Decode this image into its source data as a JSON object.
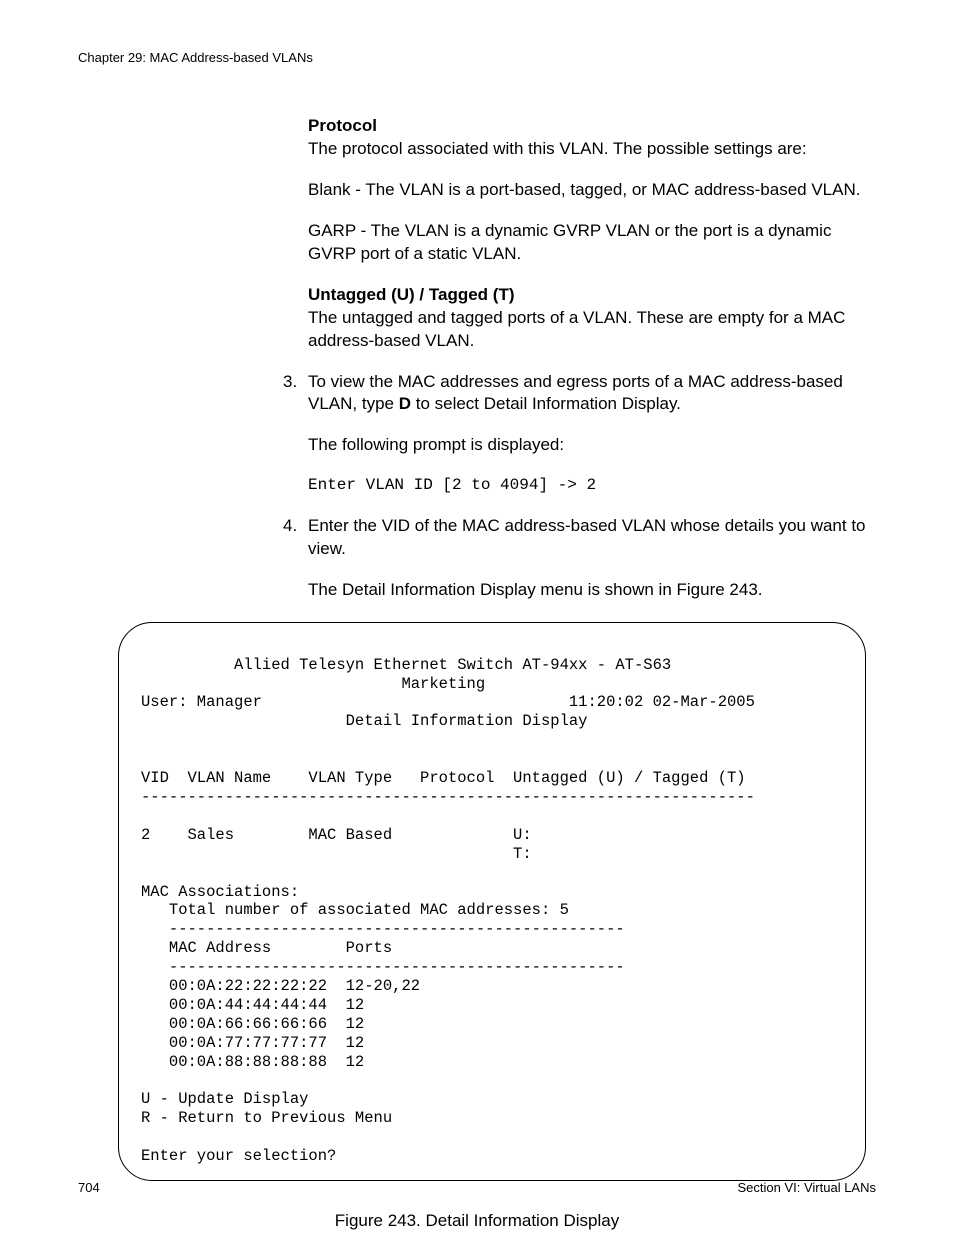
{
  "header": {
    "chapter": "Chapter 29: MAC Address-based VLANs"
  },
  "protocol": {
    "title": "Protocol",
    "desc": "The protocol associated with this VLAN. The possible settings are:",
    "blank": "Blank - The VLAN is a port-based, tagged, or MAC address-based VLAN.",
    "garp": "GARP - The VLAN is a dynamic GVRP VLAN or the port is a dynamic GVRP port of a static VLAN."
  },
  "untagged": {
    "title": "Untagged (U) / Tagged (T)",
    "desc": "The untagged and tagged ports of a VLAN. These are empty for a MAC address-based VLAN."
  },
  "step3": {
    "marker": "3.",
    "text_a": "To view the MAC addresses and egress ports of a MAC address-based VLAN, type ",
    "key": "D",
    "text_b": " to select Detail Information Display.",
    "followup": "The following prompt is displayed:",
    "prompt": "Enter VLAN ID [2 to 4094] -> 2"
  },
  "step4": {
    "marker": "4.",
    "text": "Enter the VID of the MAC address-based VLAN whose details you want to view.",
    "followup": "The Detail Information Display menu is shown in Figure 243."
  },
  "terminal": {
    "line1": "          Allied Telesyn Ethernet Switch AT-94xx - AT-S63",
    "line2": "                            Marketing",
    "line3": "User: Manager                                 11:20:02 02-Mar-2005",
    "line4": "                      Detail Information Display",
    "blank": "",
    "hdr": "VID  VLAN Name    VLAN Type   Protocol  Untagged (U) / Tagged (T)",
    "rule1": "------------------------------------------------------------------",
    "row1": "2    Sales        MAC Based             U:",
    "row1b": "                                        T:",
    "assoc": "MAC Associations:",
    "total": "   Total number of associated MAC addresses: 5",
    "rule2": "   -------------------------------------------------",
    "machdr": "   MAC Address        Ports",
    "rule3": "   -------------------------------------------------",
    "m1": "   00:0A:22:22:22:22  12-20,22",
    "m2": "   00:0A:44:44:44:44  12",
    "m3": "   00:0A:66:66:66:66  12",
    "m4": "   00:0A:77:77:77:77  12",
    "m5": "   00:0A:88:88:88:88  12",
    "optU": "U - Update Display",
    "optR": "R - Return to Previous Menu",
    "sel": "Enter your selection?"
  },
  "figure": {
    "caption": "Figure 243. Detail Information Display"
  },
  "footer": {
    "page": "704",
    "section": "Section VI: Virtual LANs"
  }
}
